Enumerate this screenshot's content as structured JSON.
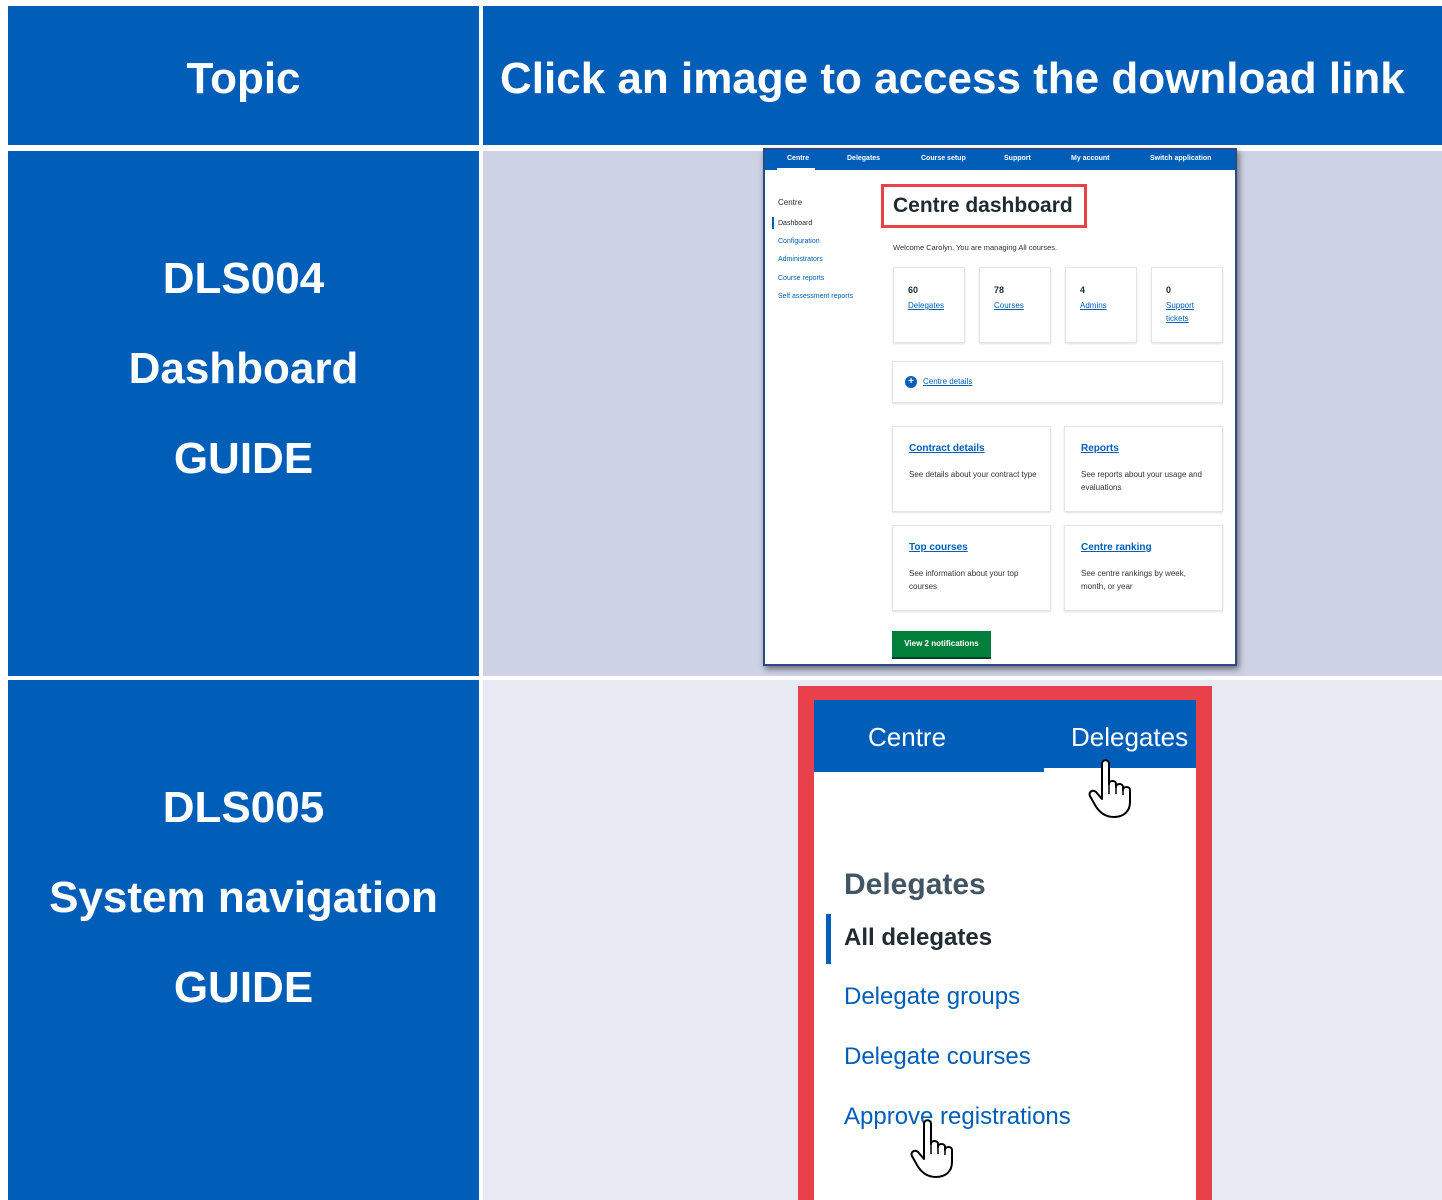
{
  "header": {
    "topic": "Topic",
    "instruction": "Click an image to access the download link"
  },
  "rows": [
    {
      "code": "DLS004",
      "name": "Dashboard",
      "kind": "GUIDE",
      "image": {
        "nav": [
          "Centre",
          "Delegates",
          "Course setup",
          "Support",
          "My account",
          "Switch application"
        ],
        "sidebar_title": "Centre",
        "sidebar": [
          "Dashboard",
          "Configuration",
          "Administrators",
          "Course reports",
          "Self assessment reports"
        ],
        "title": "Centre dashboard",
        "welcome": "Welcome Carolyn. You are managing All courses.",
        "stats": [
          {
            "num": "60",
            "label": "Delegates"
          },
          {
            "num": "78",
            "label": "Courses"
          },
          {
            "num": "4",
            "label": "Admins"
          },
          {
            "num": "0",
            "label": "Support tickets"
          }
        ],
        "centre_details": "Centre details",
        "cards": [
          {
            "title": "Contract details",
            "desc": "See details about your contract type"
          },
          {
            "title": "Reports",
            "desc": "See reports about your usage and evaluations"
          },
          {
            "title": "Top courses",
            "desc": "See information about your top courses"
          },
          {
            "title": "Centre ranking",
            "desc": "See centre rankings by week, month, or year"
          }
        ],
        "button": "View 2 notifications"
      }
    },
    {
      "code": "DLS005",
      "name": "System navigation",
      "kind": "GUIDE",
      "image": {
        "nav": [
          "Centre",
          "Delegates"
        ],
        "heading": "Delegates",
        "items": [
          "All delegates",
          "Delegate groups",
          "Delegate courses",
          "Approve registrations"
        ]
      }
    }
  ],
  "colors": {
    "brand_blue": "#005eb8",
    "highlight_red": "#e8414b",
    "row1_bg": "#cdd3e5",
    "row2_bg": "#e8eaf3",
    "green_button": "#007f3b"
  }
}
